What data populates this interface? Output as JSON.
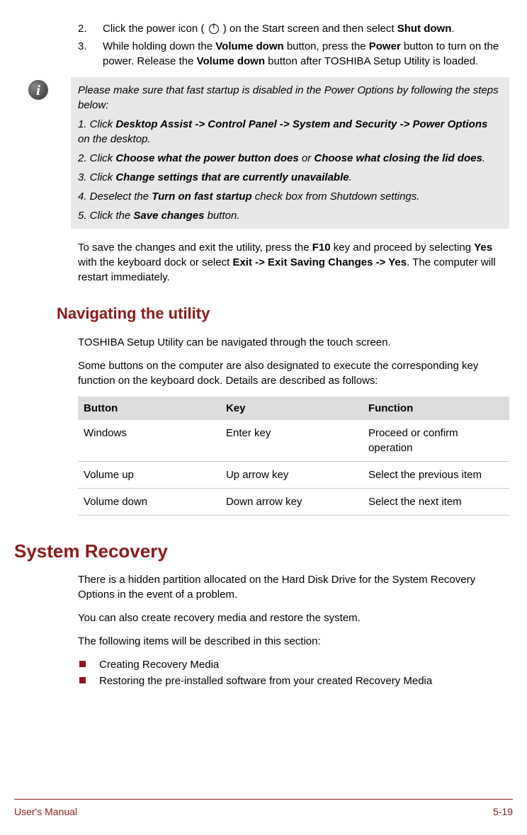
{
  "steps": {
    "item2": {
      "num": "2.",
      "text_a": "Click the power icon ( ",
      "text_b": " ) on the Start screen and then select ",
      "bold_shut": "Shut down",
      "text_c": "."
    },
    "item3": {
      "num": "3.",
      "text_a": "While holding down the ",
      "bold_vd1": "Volume down",
      "text_b": " button, press the ",
      "bold_power": "Power",
      "text_c": " button to turn on the power. Release the ",
      "bold_vd2": "Volume down",
      "text_d": " button after TOSHIBA Setup Utility is loaded."
    }
  },
  "note": {
    "intro": "Please make sure that fast startup is disabled in the Power Options by following the steps below:",
    "s1_a": "1. Click ",
    "s1_bold": "Desktop Assist -> Control Panel -> System and Security -> Power Options",
    "s1_b": " on the desktop.",
    "s2_a": "2. Click ",
    "s2_bold1": "Choose what the power button does",
    "s2_mid": " or ",
    "s2_bold2": "Choose what closing the lid does",
    "s2_b": ".",
    "s3_a": "3. Click ",
    "s3_bold": "Change settings that are currently unavailable",
    "s3_b": ".",
    "s4_a": "4. Deselect the ",
    "s4_bold": "Turn on fast startup",
    "s4_b": " check box from Shutdown settings.",
    "s5_a": "5. Click the ",
    "s5_bold": "Save changes",
    "s5_b": " button."
  },
  "exit_para": {
    "a": "To save the changes and exit the utility, press the ",
    "b_f10": "F10",
    "c": " key and proceed by selecting ",
    "b_yes": "Yes",
    "d": " with the keyboard dock or select ",
    "b_exit": "Exit -> Exit Saving Changes -> Yes",
    "e": ". The computer will restart immediately."
  },
  "nav": {
    "heading": "Navigating the utility",
    "p1": "TOSHIBA Setup Utility can be navigated through the touch screen.",
    "p2": "Some buttons on the computer are also designated to execute the corresponding key function on the keyboard dock. Details are described as follows:",
    "table": {
      "h1": "Button",
      "h2": "Key",
      "h3": "Function",
      "rows": [
        {
          "c1": "Windows",
          "c2": "Enter key",
          "c3": "Proceed or confirm operation"
        },
        {
          "c1": "Volume up",
          "c2": "Up arrow key",
          "c3": "Select the previous item"
        },
        {
          "c1": "Volume down",
          "c2": "Down arrow key",
          "c3": "Select the next item"
        }
      ]
    }
  },
  "recovery": {
    "heading": "System Recovery",
    "p1": "There is a hidden partition allocated on the Hard Disk Drive for the System Recovery Options in the event of a problem.",
    "p2": "You can also create recovery media and restore the system.",
    "p3": "The following items will be described in this section:",
    "bullets": [
      "Creating Recovery Media",
      "Restoring the pre-installed software from your created Recovery Media"
    ]
  },
  "footer": {
    "left": "User's Manual",
    "right": "5-19"
  },
  "info_glyph": "i"
}
